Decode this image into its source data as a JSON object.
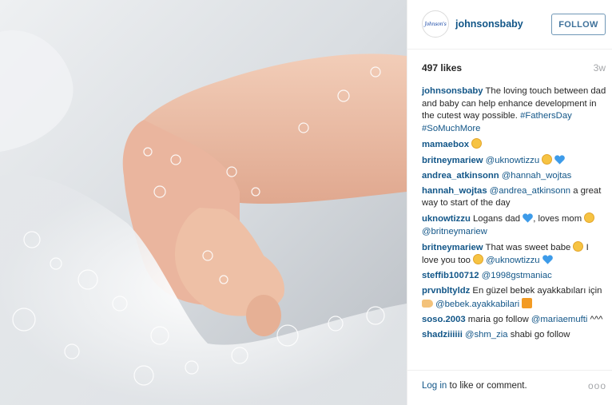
{
  "post": {
    "username": "johnsonsbaby",
    "avatar_text": "Johnson's",
    "follow_label": "FOLLOW",
    "likes": "497 likes",
    "age": "3w"
  },
  "comments": [
    {
      "user": "johnsonsbaby",
      "text": "The loving touch between dad and baby can help enhance development in the cutest way possible.",
      "tags": "#FathersDay #SoMuchMore"
    },
    {
      "user": "mamaebox",
      "text": ""
    },
    {
      "user": "britneymariew",
      "mention": "@uknowtizzu"
    },
    {
      "user": "andrea_atkinsonn",
      "mention": "@hannah_wojtas"
    },
    {
      "user": "hannah_wojtas",
      "mention": "@andrea_atkinsonn",
      "text": "a great way to start of the day"
    },
    {
      "user": "uknowtizzu",
      "text": "Logans dad",
      "text2": ", loves mom",
      "mention": "@britneymariew"
    },
    {
      "user": "britneymariew",
      "text": "That was sweet babe",
      "text2": "I love you too",
      "mention": "@uknowtizzu"
    },
    {
      "user": "steffib100712",
      "mention": "@1998gstmaniac"
    },
    {
      "user": "prvnbltyldz",
      "text": "En güzel bebek ayakkabıları için",
      "mention": "@bebek.ayakkabilari"
    },
    {
      "user": "soso.2003",
      "text": "maria go follow",
      "mention": "@mariaemufti",
      "text2": "^^^"
    },
    {
      "user": "shadziiiiii",
      "mention": "@shm_zia",
      "text": "shabi go follow"
    }
  ],
  "footer": {
    "login_link": "Log in",
    "login_rest": " to like or comment.",
    "more": "ooo"
  },
  "icons": {
    "heart_color": "#3d9be9",
    "face_color": "#f6c343"
  }
}
